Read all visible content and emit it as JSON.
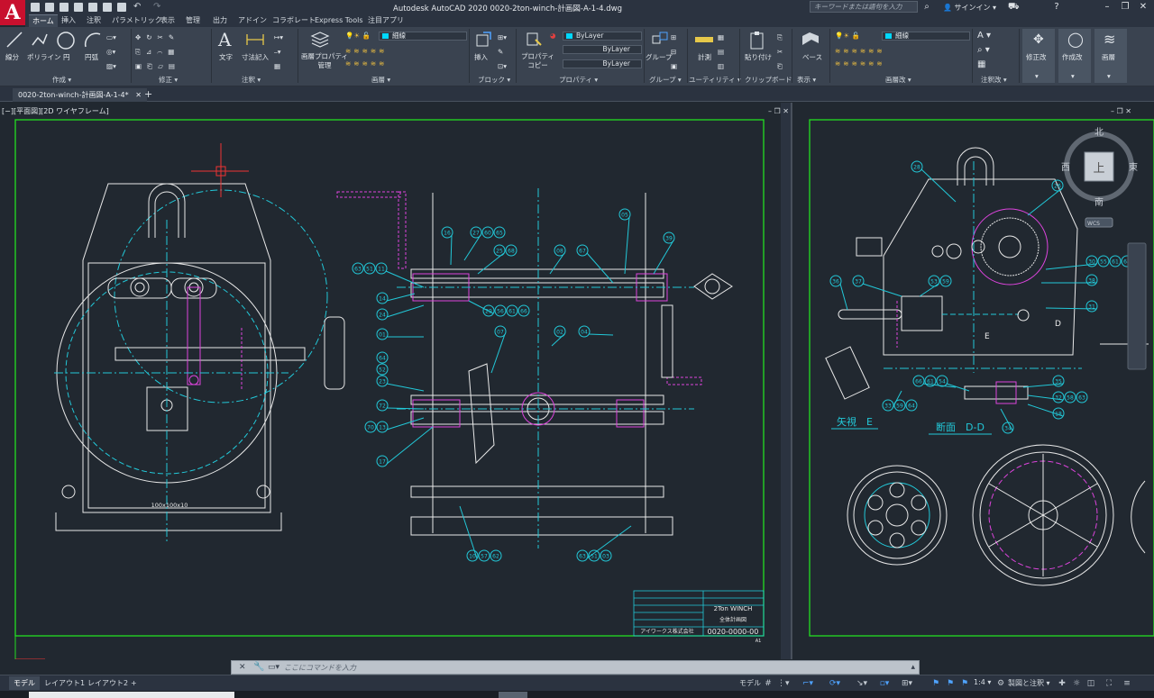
{
  "window": {
    "title": "Autodesk AutoCAD 2020    0020-2ton-winch-計画図-A-1-4.dwg",
    "search_placeholder": "キーワードまたは語句を入力",
    "signin": "サインイン",
    "logo": "A"
  },
  "ribbon_tabs": [
    "ホーム",
    "挿入",
    "注釈",
    "パラメトリック",
    "表示",
    "管理",
    "出力",
    "アドイン",
    "コラボレート",
    "Express Tools",
    "注目アプリ"
  ],
  "ribbon": {
    "draw": {
      "line": "線分",
      "polyline": "ポリライン",
      "circle": "円",
      "arc": "円弧",
      "title": "作成 ▾"
    },
    "modify": {
      "title": "修正 ▾"
    },
    "annotation": {
      "text": "文字",
      "dimension": "寸法記入",
      "title": "注釈 ▾"
    },
    "layers": {
      "props": "画層プロパティ\n管理",
      "layer_value": "細線",
      "title": "画層 ▾"
    },
    "block": {
      "insert": "挿入",
      "title": "ブロック ▾"
    },
    "properties": {
      "copy": "プロパティ\nコピー",
      "bylayer1": "ByLayer",
      "bylayer2": "ByLayer",
      "bylayer3": "ByLayer",
      "title": "プロパティ ▾"
    },
    "groups": {
      "group": "グループ",
      "title": "グループ ▾"
    },
    "utilities": {
      "measure": "計測",
      "title": "ユーティリティ ▾"
    },
    "clipboard": {
      "paste": "貼り付け",
      "title": "クリップボード"
    },
    "view": {
      "base": "ベース",
      "title": "表示 ▾"
    },
    "layers2": {
      "layer_value": "細線",
      "title": "画層改 ▾"
    },
    "annotation2": {
      "title": "注釈改 ▾"
    },
    "modify2": {
      "label": "修正改"
    },
    "create2": {
      "label": "作成改"
    },
    "layer_btn": {
      "label": "画層"
    }
  },
  "doc_tab": {
    "label": "0020-2ton-winch-計画図-A-1-4*",
    "close": "✕",
    "add": "+"
  },
  "viewport": {
    "label": "[−][平面図][2D ワイヤフレーム]"
  },
  "viewcube": {
    "north": "北",
    "south": "南",
    "east": "東",
    "west": "西",
    "face": "上",
    "wcs": "WCS"
  },
  "drawing": {
    "balloons_main": [
      "16",
      "27",
      "60",
      "65",
      "25",
      "68",
      "08",
      "67",
      "05",
      "39",
      "63",
      "51",
      "11",
      "14",
      "24",
      "29",
      "56",
      "61",
      "66",
      "02",
      "04",
      "01",
      "07",
      "64",
      "52",
      "23",
      "72",
      "70",
      "13",
      "17",
      "10",
      "57",
      "62",
      "63",
      "51",
      "03"
    ],
    "plate_label": "100x100x10",
    "title_block": {
      "name": "2Ton WINCH",
      "sub": "全体計画図",
      "company": "アイワークス株式会社",
      "number": "0020-0000-00",
      "size": "A1"
    },
    "right_balloons": [
      "28",
      "26",
      "30",
      "55",
      "61",
      "64",
      "36",
      "37",
      "53",
      "59",
      "38",
      "31",
      "66",
      "61",
      "54",
      "35",
      "32",
      "58",
      "63",
      "33",
      "59",
      "64",
      "18",
      "34"
    ],
    "label_e_view": "矢視　E",
    "label_dd": "断面　D-D",
    "label_d": "D",
    "label_e": "E"
  },
  "command": {
    "placeholder": "ここにコマンドを入力"
  },
  "status_tabs": [
    "モデル",
    "レイアウト1",
    "レイアウト2"
  ],
  "status": {
    "model": "モデル",
    "scale": "1:4",
    "workspace": "製図と注釈",
    "add": "+"
  }
}
